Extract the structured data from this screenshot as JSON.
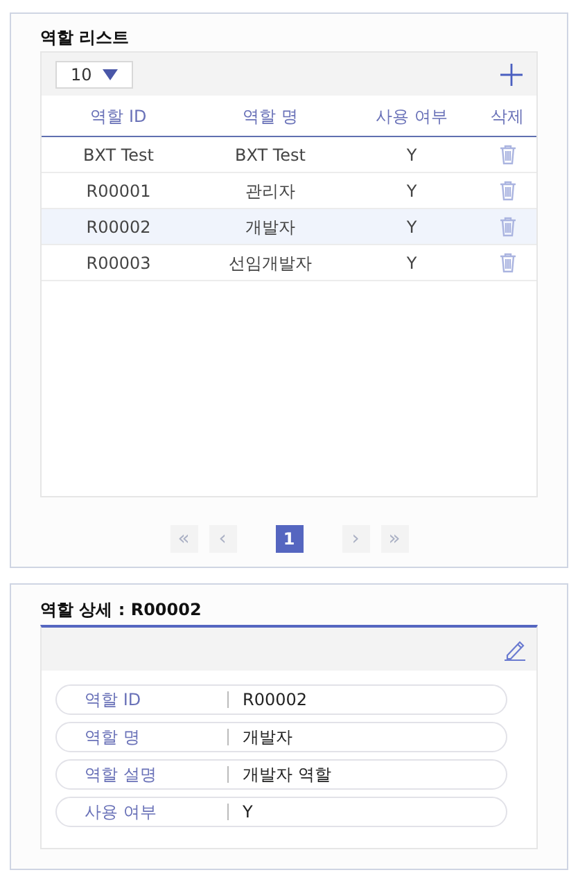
{
  "list_panel": {
    "title": "역할 리스트",
    "page_size": "10",
    "table": {
      "columns": [
        "역할 ID",
        "역할 명",
        "사용 여부",
        "삭제"
      ],
      "rows": [
        {
          "id": "BXT Test",
          "name": "BXT Test",
          "use": "Y",
          "selected": false
        },
        {
          "id": "R00001",
          "name": "관리자",
          "use": "Y",
          "selected": false
        },
        {
          "id": "R00002",
          "name": "개발자",
          "use": "Y",
          "selected": true
        },
        {
          "id": "R00003",
          "name": "선임개발자",
          "use": "Y",
          "selected": false
        }
      ]
    },
    "pager": {
      "first": "«",
      "prev": "‹",
      "pages": [
        {
          "label": "1",
          "selected": true
        }
      ],
      "next": "›",
      "last": "»"
    }
  },
  "detail_panel": {
    "title": "역할 상세 : R00002",
    "fields": [
      {
        "label": "역할 ID",
        "value": "R00002"
      },
      {
        "label": "역할 명",
        "value": "개발자"
      },
      {
        "label": "역할 설명",
        "value": "개발자 역할"
      },
      {
        "label": "사용 여부",
        "value": "Y"
      }
    ]
  }
}
